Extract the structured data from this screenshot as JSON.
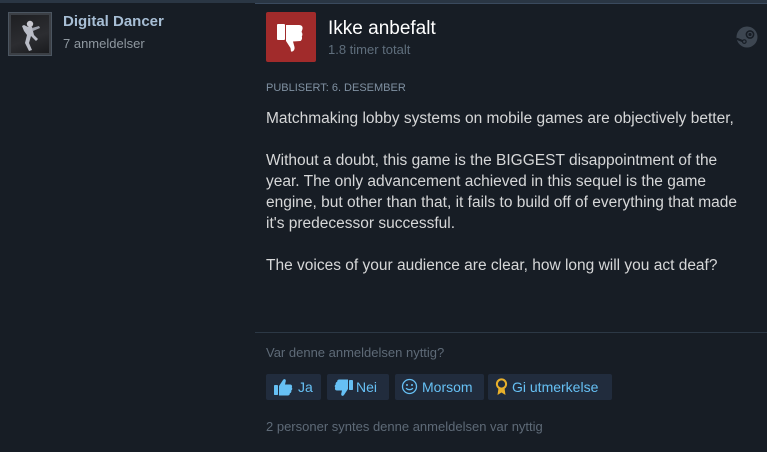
{
  "author": {
    "name": "Digital Dancer",
    "review_count": "7 anmeldelser"
  },
  "review": {
    "recommendation": "Ikke anbefalt",
    "hours": "1.8 timer totalt",
    "posted": "PUBLISERT: 6. DESEMBER",
    "paragraphs": [
      "Matchmaking lobby systems on mobile games are objectively better,",
      "Without a doubt, this game is the BIGGEST disappointment of the year. The only advancement achieved in this sequel is the game engine, but other than that, it fails to build off of everything that made it's predecessor successful.",
      "The voices of your audience are clear, how long will you act deaf?"
    ]
  },
  "feedback": {
    "question": "Var denne anmeldelsen nyttig?",
    "yes_label": "Ja",
    "no_label": "Nei",
    "funny_label": "Morsom",
    "award_label": "Gi utmerkelse",
    "helpful_count": "2 personer syntes denne anmeldelsen var nyttig"
  },
  "colors": {
    "background": "#171d25",
    "accent": "#66c0f4",
    "thumbs_down_bg": "#a12b2b",
    "award": "#e8b02b"
  },
  "icons": [
    "thumbs-down-icon",
    "steam-icon",
    "thumbs-up-icon",
    "smiley-icon",
    "award-icon"
  ]
}
